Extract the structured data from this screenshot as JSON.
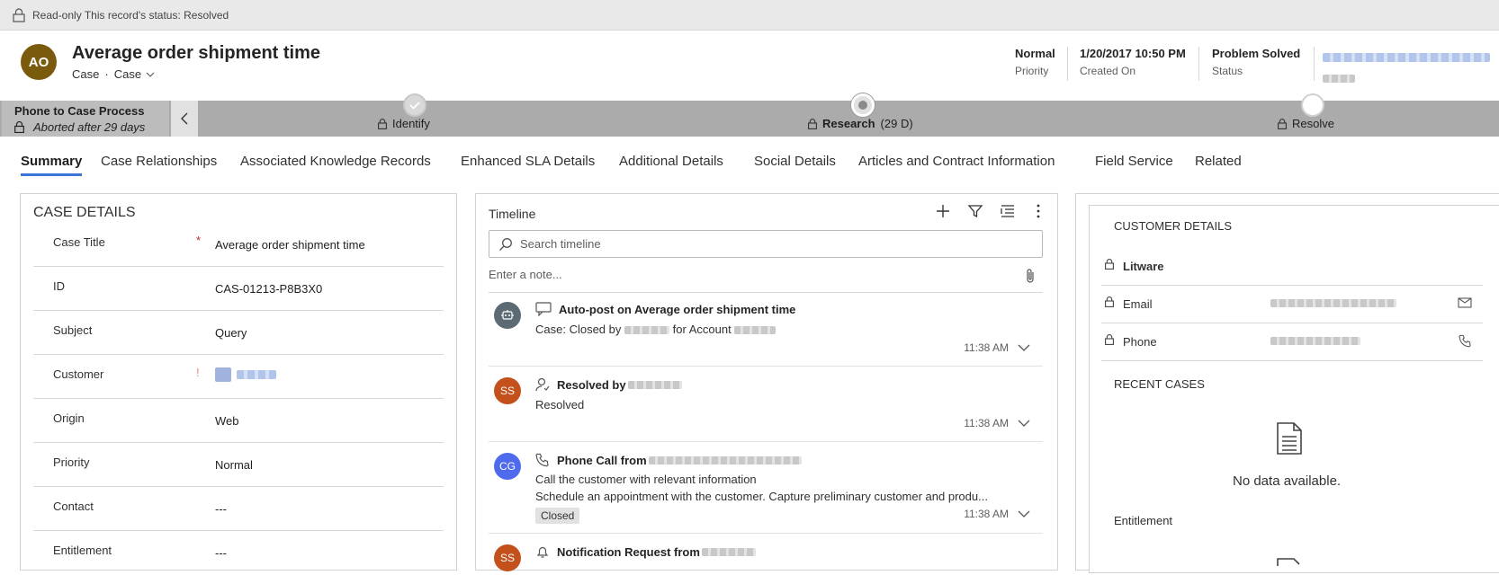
{
  "readonly_bar": {
    "text": "Read-only This record's status: Resolved"
  },
  "record": {
    "avatar_initials": "AO",
    "title": "Average order shipment time",
    "entity": "Case",
    "form": "Case"
  },
  "header_fields": [
    {
      "value": "Normal",
      "label": "Priority"
    },
    {
      "value": "1/20/2017 10:50 PM",
      "label": "Created On"
    },
    {
      "value": "Problem Solved",
      "label": "Status"
    }
  ],
  "process": {
    "name": "Phone to Case Process",
    "status": "Aborted after 29 days",
    "stages": [
      {
        "label": "Identify",
        "state": "completed"
      },
      {
        "label": "Research",
        "duration": "(29 D)",
        "state": "active"
      },
      {
        "label": "Resolve",
        "state": "pending"
      }
    ]
  },
  "tabs": [
    "Summary",
    "Case Relationships",
    "Associated Knowledge Records",
    "Enhanced SLA Details",
    "Additional Details",
    "Social Details",
    "Articles and Contract Information",
    "Field Service",
    "Related"
  ],
  "case_details": {
    "heading": "CASE DETAILS",
    "fields": [
      {
        "label": "Case Title",
        "value": "Average order shipment time",
        "required": "*"
      },
      {
        "label": "ID",
        "value": "CAS-01213-P8B3X0",
        "required": ""
      },
      {
        "label": "Subject",
        "value": "Query",
        "required": ""
      },
      {
        "label": "Customer",
        "value": "",
        "required": ""
      },
      {
        "label": "Origin",
        "value": "Web",
        "required": ""
      },
      {
        "label": "Priority",
        "value": "Normal",
        "required": ""
      },
      {
        "label": "Contact",
        "value": "---",
        "required": ""
      },
      {
        "label": "Entitlement",
        "value": "---",
        "required": ""
      }
    ]
  },
  "timeline": {
    "title": "Timeline",
    "search_placeholder": "Search timeline",
    "note_placeholder": "Enter a note...",
    "items": [
      {
        "avatar": "",
        "avatar_color": "#5c6b73",
        "title": "Auto-post on Average order shipment time",
        "lines": [
          "Case: Closed by",
          "for Account"
        ],
        "time": "11:38 AM"
      },
      {
        "avatar": "SS",
        "avatar_color": "#c4501c",
        "title": "Resolved by",
        "lines": [
          "Resolved"
        ],
        "time": "11:38 AM"
      },
      {
        "avatar": "CG",
        "avatar_color": "#4f6bed",
        "title": "Phone Call from",
        "lines": [
          "Call the customer with relevant information",
          "Schedule an appointment with the customer. Capture preliminary customer and produ..."
        ],
        "badge": "Closed",
        "time": "11:38 AM"
      },
      {
        "avatar": "SS",
        "avatar_color": "#c4501c",
        "title": "Notification Request from",
        "lines": [],
        "time": ""
      }
    ]
  },
  "customer_details": {
    "heading": "CUSTOMER DETAILS",
    "account": "Litware",
    "email_label": "Email",
    "phone_label": "Phone",
    "recent_cases_heading": "RECENT CASES",
    "no_data": "No data available.",
    "entitlement_heading": "Entitlement"
  },
  "colors": {
    "accent": "#3a76d8",
    "process_bar": "#ababab",
    "avatar": "#7a5a0c"
  }
}
